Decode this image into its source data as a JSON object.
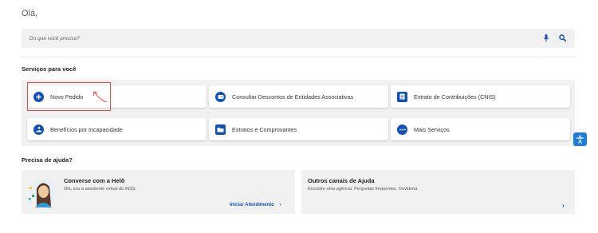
{
  "greeting": "Olá,",
  "search": {
    "placeholder": "Do que você precisa?"
  },
  "services": {
    "title": "Serviços para você",
    "items": [
      {
        "label": "Novo Pedido",
        "icon": "plus-circle-icon"
      },
      {
        "label": "Consultar Descontos de Entidades Associativas",
        "icon": "wallet-icon"
      },
      {
        "label": "Extrato de Contribuições (CNIS)",
        "icon": "document-icon"
      },
      {
        "label": "Benefícios por Incapacidade",
        "icon": "hand-care-icon"
      },
      {
        "label": "Extratos e Comprovantes",
        "icon": "folder-icon"
      },
      {
        "label": "Mais Serviços",
        "icon": "more-icon"
      }
    ]
  },
  "help": {
    "title": "Precisa de ajuda?",
    "chat": {
      "title": "Converse com a Helô",
      "subtitle": "Olá, sou a assistente virtual do INSS",
      "link": "Iniciar Atendimento",
      "link_arrow": "›"
    },
    "other": {
      "title": "Outros canais de Ajuda",
      "subtitle": "Encontre uma agência. Perguntas frequentes. Ouvidoria",
      "link_arrow": "›"
    }
  },
  "colors": {
    "primary": "#1351b4",
    "panel": "#f1f1f1",
    "highlight": "#e24a4a"
  }
}
